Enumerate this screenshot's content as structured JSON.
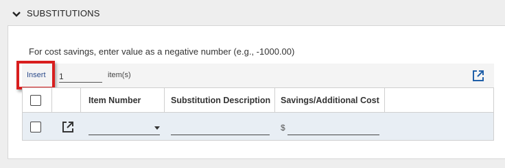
{
  "section": {
    "title": "SUBSTITUTIONS",
    "hint": "For cost savings, enter value as a negative number (e.g., -1000.00)"
  },
  "toolbar": {
    "insert_label": "Insert",
    "quantity_value": "1",
    "items_label": "item(s)"
  },
  "table": {
    "columns": [
      "",
      "",
      "Item Number",
      "Substitution Description",
      "Savings/Additional Cost"
    ],
    "rows": [
      {
        "item_number": "",
        "description": "",
        "currency_symbol": "$",
        "cost": ""
      }
    ]
  },
  "colors": {
    "highlight": "#d81e1e",
    "insert_link": "#2a4a8a",
    "row_background": "#e8eef4"
  },
  "icons": [
    "chevron-down-icon",
    "open-in-new-icon"
  ]
}
